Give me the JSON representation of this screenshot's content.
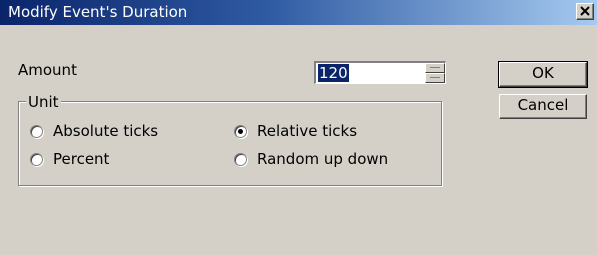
{
  "window": {
    "title": "Modify Event's Duration",
    "close_glyph": "×"
  },
  "amount": {
    "label": "Amount",
    "value": "120"
  },
  "buttons": {
    "ok": "OK",
    "cancel": "Cancel"
  },
  "unit": {
    "label": "Unit",
    "options": [
      {
        "label": "Absolute ticks",
        "selected": false
      },
      {
        "label": "Relative ticks",
        "selected": true
      },
      {
        "label": "Percent",
        "selected": false
      },
      {
        "label": "Random up down",
        "selected": false
      }
    ]
  },
  "colors": {
    "titlebar_start": "#0a246a",
    "titlebar_end": "#a6caf0",
    "face": "#d4d0c8"
  }
}
